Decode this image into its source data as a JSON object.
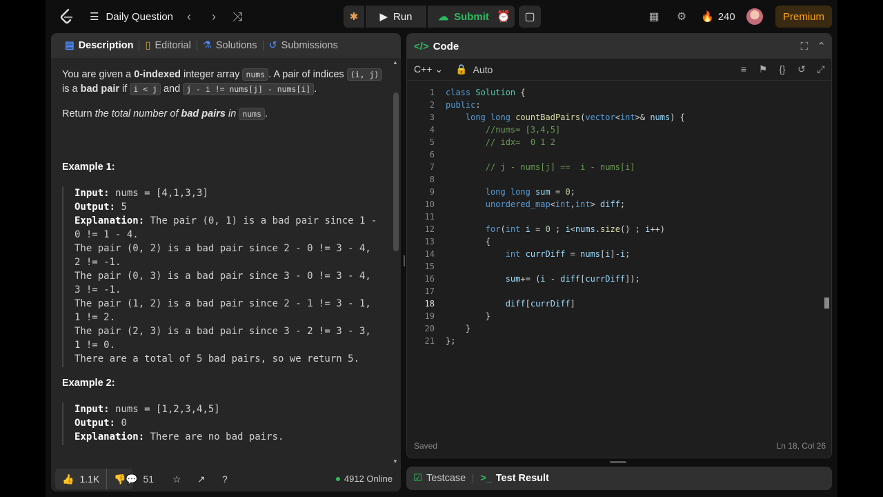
{
  "topbar": {
    "daily_question": "Daily Question",
    "run_label": "Run",
    "submit_label": "Submit",
    "streak": "240",
    "premium": "Premium"
  },
  "tabs": [
    {
      "label": "Description",
      "icon": "document-icon"
    },
    {
      "label": "Editorial",
      "icon": "book-icon"
    },
    {
      "label": "Solutions",
      "icon": "flask-icon"
    },
    {
      "label": "Submissions",
      "icon": "history-icon"
    }
  ],
  "description": {
    "p1_a": "You are given a ",
    "p1_b": "0-indexed",
    "p1_c": " integer array ",
    "p1_d": "nums",
    "p1_e": ". A pair of indices ",
    "p1_f": "(i, j)",
    "p1_g": " is a ",
    "p1_h": "bad pair",
    "p1_i": " if ",
    "p1_j": "i < j",
    "p1_k": " and ",
    "p1_l": "j - i != nums[j] - nums[i]",
    "p1_m": ".",
    "p2_a": "Return ",
    "p2_b": "the total number of ",
    "p2_c": "bad pairs",
    "p2_d": " in ",
    "p2_e": "nums",
    "p2_f": "."
  },
  "example1": {
    "title": "Example 1:",
    "input_label": "Input:",
    "input_value": " nums = [4,1,3,3]",
    "output_label": "Output:",
    "output_value": " 5",
    "explanation_label": "Explanation:",
    "explanation_value": " The pair (0, 1) is a bad pair since 1 - 0 != 1 - 4.\nThe pair (0, 2) is a bad pair since 2 - 0 != 3 - 4, 2 != -1.\nThe pair (0, 3) is a bad pair since 3 - 0 != 3 - 4, 3 != -1.\nThe pair (1, 2) is a bad pair since 2 - 1 != 3 - 1, 1 != 2.\nThe pair (2, 3) is a bad pair since 3 - 2 != 3 - 3, 1 != 0.\nThere are a total of 5 bad pairs, so we return 5."
  },
  "example2": {
    "title": "Example 2:",
    "input_label": "Input:",
    "input_value": " nums = [1,2,3,4,5]",
    "output_label": "Output:",
    "output_value": " 0",
    "explanation_label": "Explanation:",
    "explanation_value": " There are no bad pairs."
  },
  "footer": {
    "likes": "1.1K",
    "comments": "51",
    "online": "4912 Online"
  },
  "code_panel": {
    "title": "Code",
    "language": "C++",
    "mode": "Auto",
    "status_left": "Saved",
    "status_right": "Ln 18, Col 26",
    "current_line": 18,
    "lines": [
      "class Solution {",
      "public:",
      "    long long countBadPairs(vector<int>& nums) {",
      "        //nums= [3,4,5]",
      "        // idx=  0 1 2",
      "",
      "        // j - nums[j] ==  i - nums[i]",
      "",
      "        long long sum = 0;",
      "        unordered_map<int,int> diff;",
      "",
      "        for(int i = 0 ; i<nums.size() ; i++)",
      "        {",
      "            int currDiff = nums[i]-i;",
      "",
      "            sum+= (i - diff[currDiff]);",
      "",
      "            diff[currDiff]",
      "        }",
      "    }",
      "};"
    ]
  },
  "bottom_tabs": {
    "testcase": "Testcase",
    "test_result": "Test Result"
  },
  "colors": {
    "accent_orange": "#ffa116",
    "submit_green": "#2cbb5d"
  }
}
